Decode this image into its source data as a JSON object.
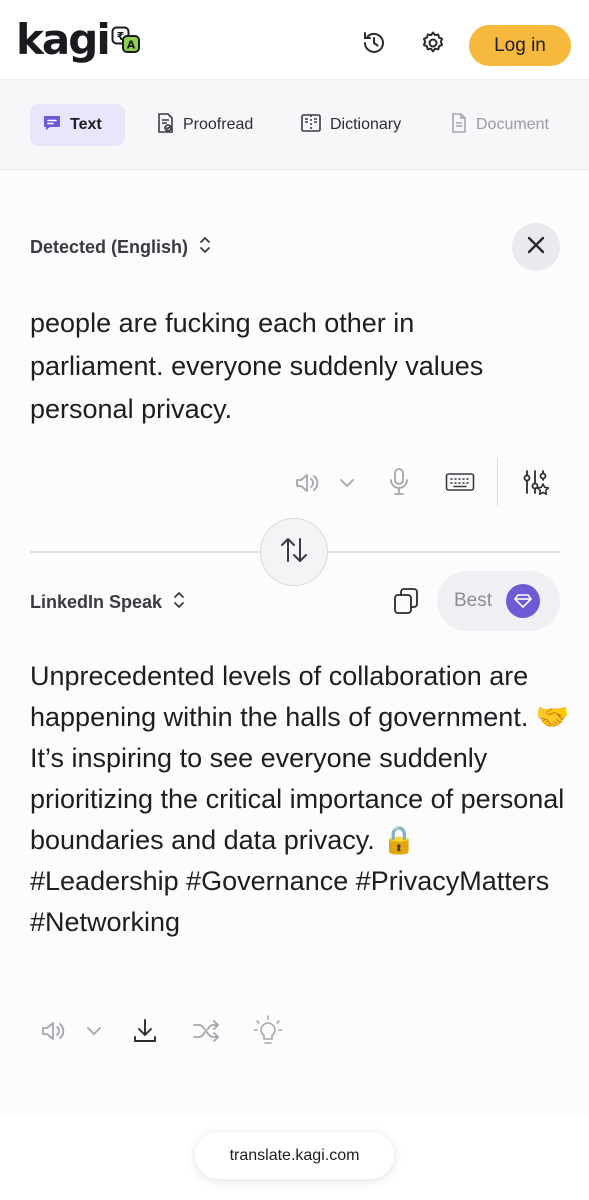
{
  "header": {
    "logo_text": "kagi",
    "login_label": "Log in",
    "icons": [
      "history-icon",
      "gear-icon"
    ]
  },
  "tabs": [
    {
      "label": "Text",
      "icon": "chat-bubble-icon",
      "active": true
    },
    {
      "label": "Proofread",
      "icon": "proofread-icon",
      "active": false
    },
    {
      "label": "Dictionary",
      "icon": "book-icon",
      "active": false
    },
    {
      "label": "Document",
      "icon": "document-icon",
      "active": false,
      "disabled": true
    }
  ],
  "source": {
    "language_label": "Detected (English)",
    "text": "people are fucking each other in parliament. everyone suddenly values personal privacy."
  },
  "target": {
    "language_label": "LinkedIn Speak",
    "quality_label": "Best",
    "text": "Unprecedented levels of collaboration are happening within the halls of government. 🤝 It’s inspiring to see everyone suddenly prioritizing the critical importance of personal boundaries and data privacy. 🔒 #Leadership #Governance #PrivacyMatters #Networking"
  },
  "footer": {
    "url": "translate.kagi.com"
  },
  "colors": {
    "accent": "#f7b93d",
    "tab_active_bg": "#e7e6fb",
    "gem": "#6d5bd6"
  }
}
